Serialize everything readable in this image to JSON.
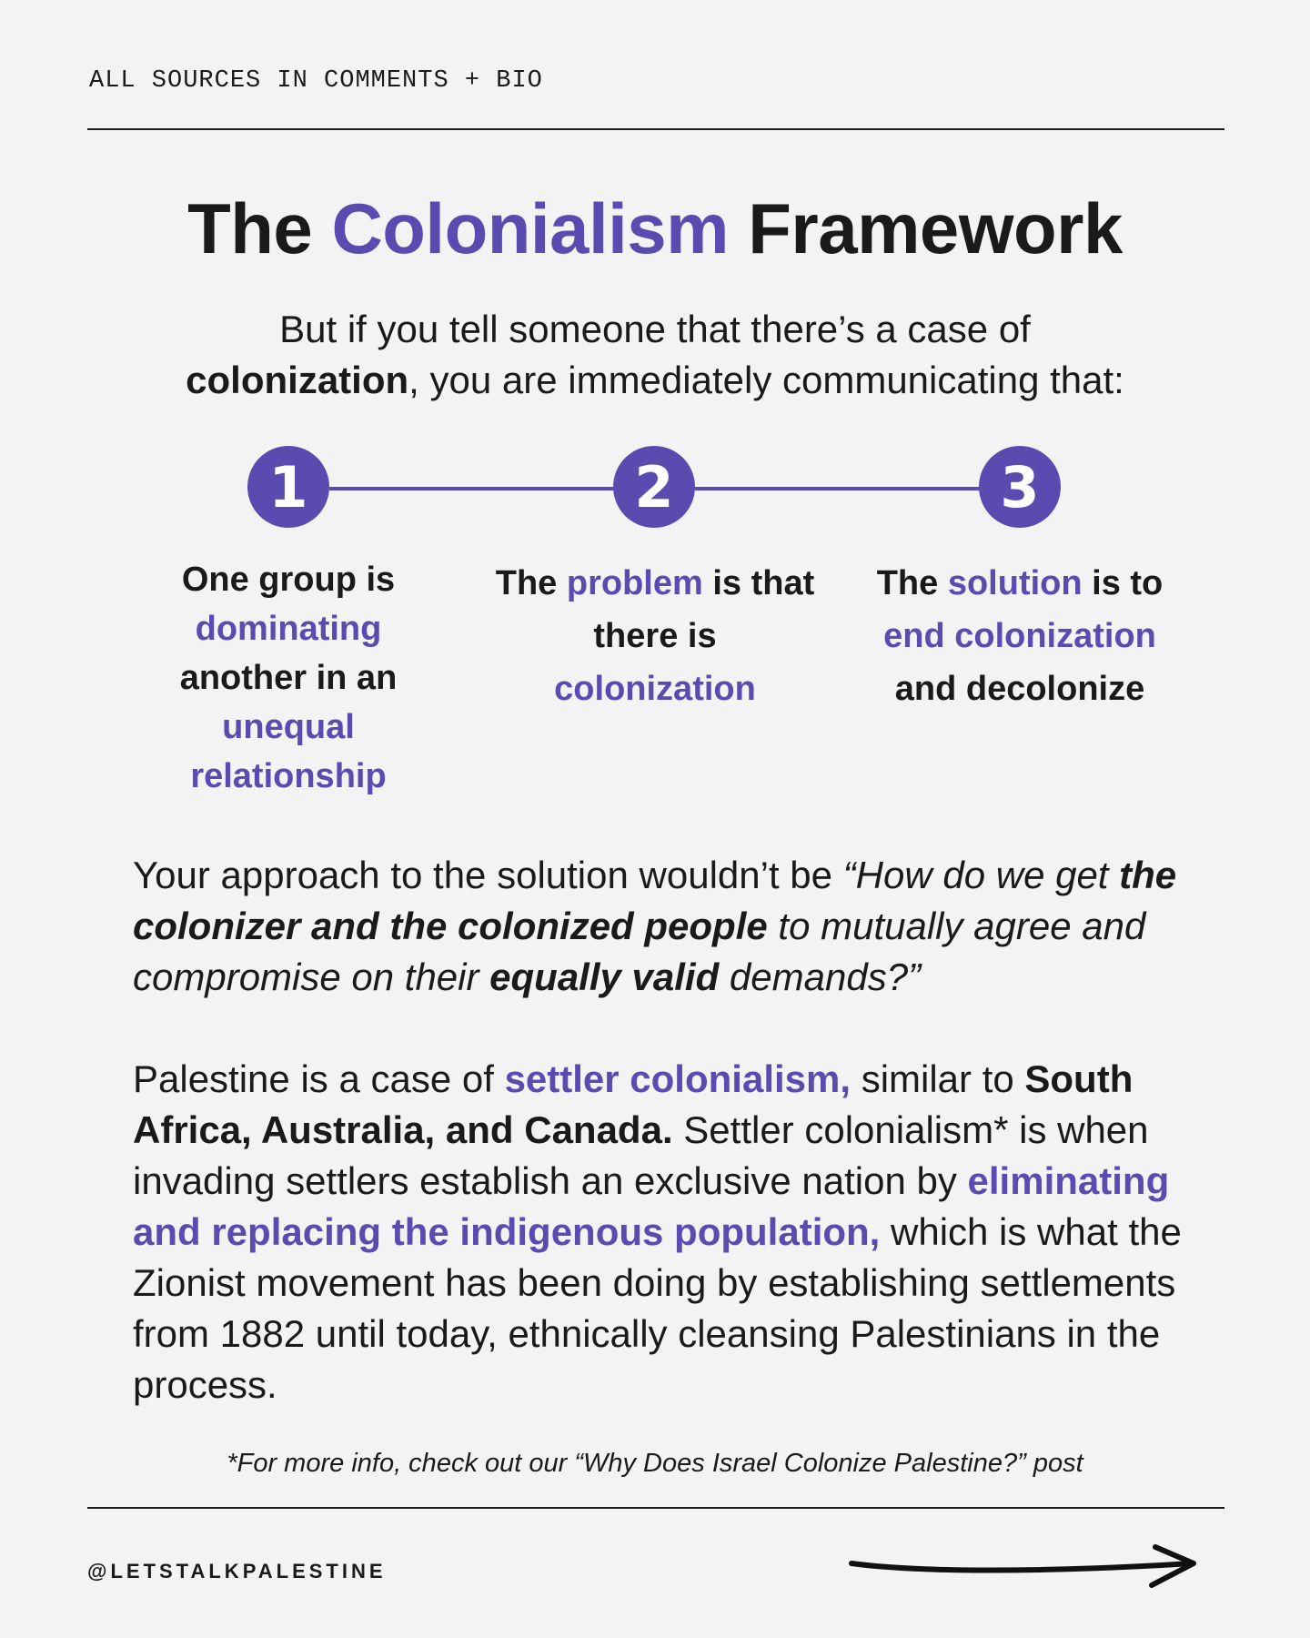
{
  "header": {
    "sources_label": "ALL SOURCES IN COMMENTS + BIO"
  },
  "title": {
    "part1": "The ",
    "accent": "Colonialism",
    "part2": " Framework"
  },
  "intro": {
    "line1": "But if you tell someone that there’s a case of",
    "bold": "colonization",
    "rest": ", you are immediately communicating that:"
  },
  "steps": [
    {
      "number": "1",
      "t1": "One group is",
      "a1": "dominating",
      "t2": "another in an",
      "a2": "unequal relationship"
    },
    {
      "number": "2",
      "t1": "The ",
      "a1": "problem",
      "t2": " is that there is",
      "a2": "colonization"
    },
    {
      "number": "3",
      "t1": "The ",
      "a1": "solution",
      "t2": " is to",
      "a2": "end colonization",
      "t3": "and decolonize"
    }
  ],
  "approach": {
    "p1": "Your approach to the solution wouldn’t be ",
    "i1": "“How do we get ",
    "b1": "the colonizer and the colonized people",
    "i2": " to mutually agree and compromise on their ",
    "b2": "equally valid",
    "i3": " demands?”"
  },
  "palestine": {
    "p1": "Palestine is a case of ",
    "a1": "settler colonialism,",
    "p2": " similar to ",
    "b1": "South Africa, Australia, and Canada.",
    "p3": " Settler colonialism* is when invading settlers establish an exclusive nation by ",
    "a2": "eliminating and replacing the indigenous population,",
    "p4": " which is what the Zionist movement has been doing by establishing settlements from 1882 until today, ethnically cleansing Palestinians in the process."
  },
  "footnote": "*For more info, check out our “Why Does Israel Colonize Palestine?” post",
  "footer": {
    "handle": "@LETSTALKPALESTINE",
    "arrow_icon": "arrow-right-icon"
  },
  "colors": {
    "accent": "#5a4bb0",
    "text": "#1a1a1a",
    "background": "#f3f3f3"
  }
}
